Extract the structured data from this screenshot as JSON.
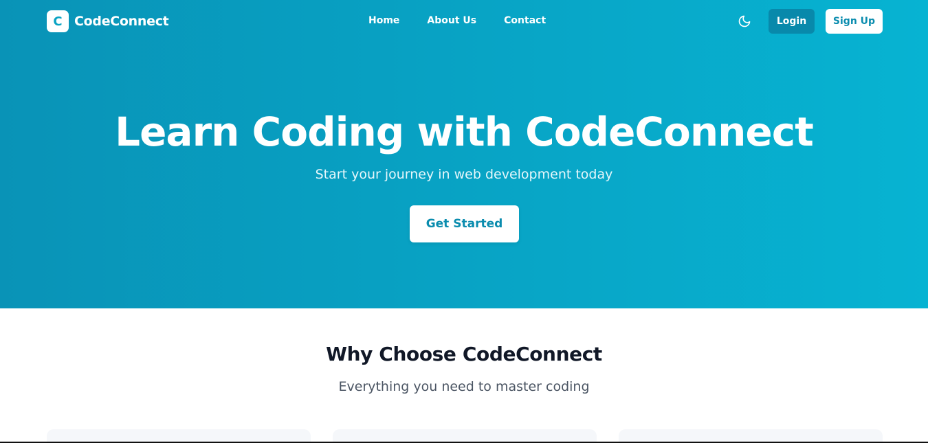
{
  "brand": {
    "logo_letter": "C",
    "name": "CodeConnect"
  },
  "nav": {
    "links": [
      {
        "label": "Home"
      },
      {
        "label": "About Us"
      },
      {
        "label": "Contact"
      }
    ],
    "theme_toggle_icon": "moon-icon",
    "login_label": "Login",
    "signup_label": "Sign Up"
  },
  "hero": {
    "title": "Learn Coding with CodeConnect",
    "subtitle": "Start your journey in web development today",
    "cta_label": "Get Started"
  },
  "features": {
    "title": "Why Choose CodeConnect",
    "subtitle": "Everything you need to master coding"
  },
  "colors": {
    "hero_gradient_start": "#0993b7",
    "hero_gradient_end": "#07b3d2",
    "accent": "#0a8cae",
    "login_bg": "#0889ab"
  }
}
